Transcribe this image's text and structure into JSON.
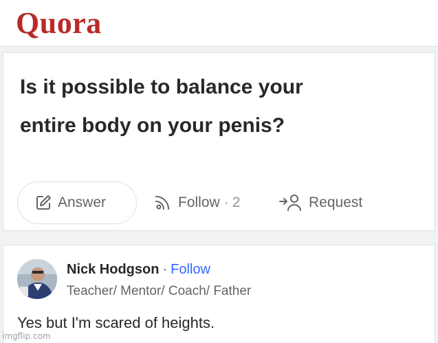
{
  "header": {
    "logo_text": "Quora",
    "brand_color": "#b92b27"
  },
  "question": {
    "title_line_1": "Is it possible to balance your",
    "title_line_2": "entire body on your penis?",
    "actions": {
      "answer": {
        "label": "Answer",
        "icon": "pencil-square-icon"
      },
      "follow": {
        "label": "Follow",
        "separator": "·",
        "count": "2",
        "icon": "rss-feed-icon"
      },
      "request": {
        "label": "Request",
        "icon": "request-user-icon"
      }
    }
  },
  "answer": {
    "author_name": "Nick Hodgson",
    "separator": "·",
    "follow_label": "Follow",
    "author_bio": "Teacher/ Mentor/ Coach/ Father",
    "text": "Yes but I'm scared of heights.",
    "link_color": "#2e69ff"
  },
  "watermark": "imgflip.com"
}
